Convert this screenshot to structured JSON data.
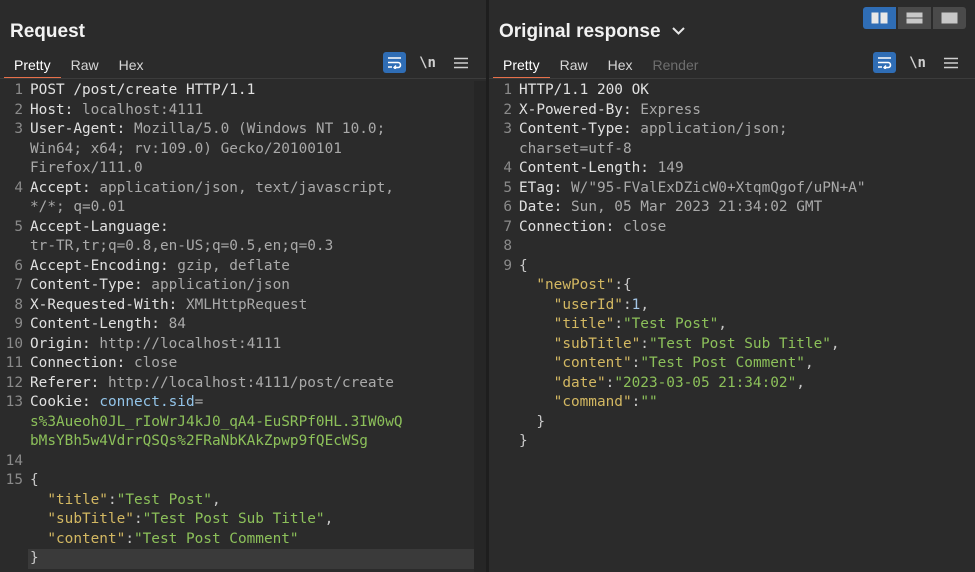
{
  "layout_modes": [
    "side-by-side",
    "stacked",
    "single"
  ],
  "request": {
    "title": "Request",
    "tabs": [
      {
        "label": "Pretty",
        "active": true
      },
      {
        "label": "Raw",
        "active": false
      },
      {
        "label": "Hex",
        "active": false
      }
    ],
    "newline_label": "\\n",
    "lines": [
      {
        "n": "1",
        "tokens": [
          {
            "t": "POST /post/create HTTP/1.1",
            "c": "kw"
          }
        ]
      },
      {
        "n": "2",
        "tokens": [
          {
            "t": "Host:",
            "c": "hk"
          },
          {
            "t": " localhost:4111",
            "c": "hv"
          }
        ]
      },
      {
        "n": "3",
        "tokens": [
          {
            "t": "User-Agent:",
            "c": "hk"
          },
          {
            "t": " Mozilla/5.0 (Windows NT 10.0;",
            "c": "hv"
          }
        ]
      },
      {
        "n": "",
        "tokens": [
          {
            "t": "Win64; x64; rv:109.0) Gecko/20100101",
            "c": "hv"
          }
        ]
      },
      {
        "n": "",
        "tokens": [
          {
            "t": "Firefox/111.0",
            "c": "hv"
          }
        ]
      },
      {
        "n": "4",
        "tokens": [
          {
            "t": "Accept:",
            "c": "hk"
          },
          {
            "t": " application/json, text/javascript,",
            "c": "hv"
          }
        ]
      },
      {
        "n": "",
        "tokens": [
          {
            "t": "*/*; q=0.01",
            "c": "hv"
          }
        ]
      },
      {
        "n": "5",
        "tokens": [
          {
            "t": "Accept-Language:",
            "c": "hk"
          }
        ]
      },
      {
        "n": "",
        "tokens": [
          {
            "t": "tr-TR,tr;q=0.8,en-US;q=0.5,en;q=0.3",
            "c": "hv"
          }
        ]
      },
      {
        "n": "6",
        "tokens": [
          {
            "t": "Accept-Encoding:",
            "c": "hk"
          },
          {
            "t": " gzip, deflate",
            "c": "hv"
          }
        ]
      },
      {
        "n": "7",
        "tokens": [
          {
            "t": "Content-Type:",
            "c": "hk"
          },
          {
            "t": " application/json",
            "c": "hv"
          }
        ]
      },
      {
        "n": "8",
        "tokens": [
          {
            "t": "X-Requested-With:",
            "c": "hk"
          },
          {
            "t": " XMLHttpRequest",
            "c": "hv"
          }
        ]
      },
      {
        "n": "9",
        "tokens": [
          {
            "t": "Content-Length:",
            "c": "hk"
          },
          {
            "t": " 84",
            "c": "hv"
          }
        ]
      },
      {
        "n": "10",
        "tokens": [
          {
            "t": "Origin:",
            "c": "hk"
          },
          {
            "t": " http://localhost:4111",
            "c": "hv"
          }
        ]
      },
      {
        "n": "11",
        "tokens": [
          {
            "t": "Connection:",
            "c": "hk"
          },
          {
            "t": " close",
            "c": "hv"
          }
        ]
      },
      {
        "n": "12",
        "tokens": [
          {
            "t": "Referer:",
            "c": "hk"
          },
          {
            "t": " http://localhost:4111/post/create",
            "c": "hv"
          }
        ]
      },
      {
        "n": "13",
        "tokens": [
          {
            "t": "Cookie:",
            "c": "hk"
          },
          {
            "t": " ",
            "c": "hv"
          },
          {
            "t": "connect.sid",
            "c": "ck"
          },
          {
            "t": "=",
            "c": "hv"
          }
        ]
      },
      {
        "n": "",
        "tokens": [
          {
            "t": "s%3Aueoh0JL_rIoWrJ4kJ0_qA4-EuSRPf0HL.3IW0wQ",
            "c": "cv"
          }
        ]
      },
      {
        "n": "",
        "tokens": [
          {
            "t": "bMsYBh5w4VdrrQSQs%2FRaNbKAkZpwp9fQEcWSg",
            "c": "cv"
          }
        ]
      },
      {
        "n": "14",
        "tokens": []
      },
      {
        "n": "15",
        "tokens": [
          {
            "t": "{",
            "c": "jp"
          }
        ]
      },
      {
        "n": "",
        "tokens": [
          {
            "t": "  ",
            "c": "jp"
          },
          {
            "t": "\"title\"",
            "c": "jk"
          },
          {
            "t": ":",
            "c": "jp"
          },
          {
            "t": "\"Test Post\"",
            "c": "js"
          },
          {
            "t": ",",
            "c": "jp"
          }
        ]
      },
      {
        "n": "",
        "tokens": [
          {
            "t": "  ",
            "c": "jp"
          },
          {
            "t": "\"subTitle\"",
            "c": "jk"
          },
          {
            "t": ":",
            "c": "jp"
          },
          {
            "t": "\"Test Post Sub Title\"",
            "c": "js"
          },
          {
            "t": ",",
            "c": "jp"
          }
        ]
      },
      {
        "n": "",
        "tokens": [
          {
            "t": "  ",
            "c": "jp"
          },
          {
            "t": "\"content\"",
            "c": "jk"
          },
          {
            "t": ":",
            "c": "jp"
          },
          {
            "t": "\"Test Post Comment\"",
            "c": "js"
          }
        ]
      },
      {
        "n": "",
        "tokens": [
          {
            "t": "}",
            "c": "jp"
          }
        ]
      }
    ]
  },
  "response": {
    "title": "Original response",
    "tabs": [
      {
        "label": "Pretty",
        "active": true
      },
      {
        "label": "Raw",
        "active": false
      },
      {
        "label": "Hex",
        "active": false
      },
      {
        "label": "Render",
        "active": false,
        "disabled": true
      }
    ],
    "newline_label": "\\n",
    "lines": [
      {
        "n": "1",
        "tokens": [
          {
            "t": "HTTP/1.1 200 OK",
            "c": "kw"
          }
        ]
      },
      {
        "n": "2",
        "tokens": [
          {
            "t": "X-Powered-By:",
            "c": "hk"
          },
          {
            "t": " Express",
            "c": "hv"
          }
        ]
      },
      {
        "n": "3",
        "tokens": [
          {
            "t": "Content-Type:",
            "c": "hk"
          },
          {
            "t": " application/json;",
            "c": "hv"
          }
        ]
      },
      {
        "n": "",
        "tokens": [
          {
            "t": "charset=utf-8",
            "c": "hv"
          }
        ]
      },
      {
        "n": "4",
        "tokens": [
          {
            "t": "Content-Length:",
            "c": "hk"
          },
          {
            "t": " 149",
            "c": "hv"
          }
        ]
      },
      {
        "n": "5",
        "tokens": [
          {
            "t": "ETag:",
            "c": "hk"
          },
          {
            "t": " W/\"95-FValExDZicW0+XtqmQgof/uPN+A\"",
            "c": "hv"
          }
        ]
      },
      {
        "n": "6",
        "tokens": [
          {
            "t": "Date:",
            "c": "hk"
          },
          {
            "t": " Sun, 05 Mar 2023 21:34:02 GMT",
            "c": "hv"
          }
        ]
      },
      {
        "n": "7",
        "tokens": [
          {
            "t": "Connection:",
            "c": "hk"
          },
          {
            "t": " close",
            "c": "hv"
          }
        ]
      },
      {
        "n": "8",
        "tokens": []
      },
      {
        "n": "9",
        "tokens": [
          {
            "t": "{",
            "c": "jp"
          }
        ]
      },
      {
        "n": "",
        "tokens": [
          {
            "t": "  ",
            "c": "jp"
          },
          {
            "t": "\"newPost\"",
            "c": "jk"
          },
          {
            "t": ":{",
            "c": "jp"
          }
        ]
      },
      {
        "n": "",
        "tokens": [
          {
            "t": "    ",
            "c": "jp"
          },
          {
            "t": "\"userId\"",
            "c": "jk"
          },
          {
            "t": ":",
            "c": "jp"
          },
          {
            "t": "1",
            "c": "jn"
          },
          {
            "t": ",",
            "c": "jp"
          }
        ]
      },
      {
        "n": "",
        "tokens": [
          {
            "t": "    ",
            "c": "jp"
          },
          {
            "t": "\"title\"",
            "c": "jk"
          },
          {
            "t": ":",
            "c": "jp"
          },
          {
            "t": "\"Test Post\"",
            "c": "js"
          },
          {
            "t": ",",
            "c": "jp"
          }
        ]
      },
      {
        "n": "",
        "tokens": [
          {
            "t": "    ",
            "c": "jp"
          },
          {
            "t": "\"subTitle\"",
            "c": "jk"
          },
          {
            "t": ":",
            "c": "jp"
          },
          {
            "t": "\"Test Post Sub Title\"",
            "c": "js"
          },
          {
            "t": ",",
            "c": "jp"
          }
        ]
      },
      {
        "n": "",
        "tokens": [
          {
            "t": "    ",
            "c": "jp"
          },
          {
            "t": "\"content\"",
            "c": "jk"
          },
          {
            "t": ":",
            "c": "jp"
          },
          {
            "t": "\"Test Post Comment\"",
            "c": "js"
          },
          {
            "t": ",",
            "c": "jp"
          }
        ]
      },
      {
        "n": "",
        "tokens": [
          {
            "t": "    ",
            "c": "jp"
          },
          {
            "t": "\"date\"",
            "c": "jk"
          },
          {
            "t": ":",
            "c": "jp"
          },
          {
            "t": "\"2023-03-05 21:34:02\"",
            "c": "js"
          },
          {
            "t": ",",
            "c": "jp"
          }
        ]
      },
      {
        "n": "",
        "tokens": [
          {
            "t": "    ",
            "c": "jp"
          },
          {
            "t": "\"command\"",
            "c": "jk"
          },
          {
            "t": ":",
            "c": "jp"
          },
          {
            "t": "\"\"",
            "c": "js"
          }
        ]
      },
      {
        "n": "",
        "tokens": [
          {
            "t": "  }",
            "c": "jp"
          }
        ]
      },
      {
        "n": "",
        "tokens": [
          {
            "t": "}",
            "c": "jp"
          }
        ]
      }
    ]
  }
}
